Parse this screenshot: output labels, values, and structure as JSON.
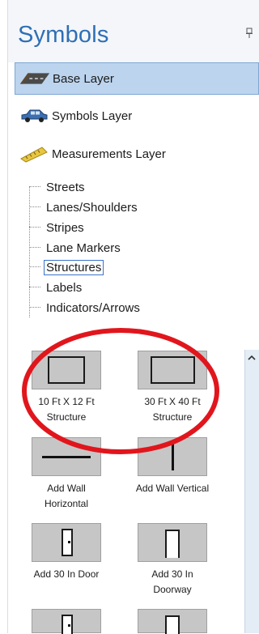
{
  "panel": {
    "title": "Symbols",
    "pin_icon": "pin-icon"
  },
  "layers": [
    {
      "label": "Base Layer",
      "icon": "asphalt-road-icon",
      "selected": true
    },
    {
      "label": "Symbols Layer",
      "icon": "car-icon",
      "selected": false
    },
    {
      "label": "Measurements Layer",
      "icon": "measuring-tape-icon",
      "selected": false
    }
  ],
  "categories": [
    {
      "label": "Streets",
      "selected": false
    },
    {
      "label": "Lanes/Shoulders",
      "selected": false
    },
    {
      "label": "Stripes",
      "selected": false
    },
    {
      "label": "Lane Markers",
      "selected": false
    },
    {
      "label": "Structures",
      "selected": true
    },
    {
      "label": "Labels",
      "selected": false
    },
    {
      "label": "Indicators/Arrows",
      "selected": false
    }
  ],
  "symbols": [
    {
      "line1": "10 Ft X 12 Ft",
      "line2": "Structure",
      "icon": "structure-10x12-icon"
    },
    {
      "line1": "30 Ft X 40 Ft",
      "line2": "Structure",
      "icon": "structure-30x40-icon"
    },
    {
      "line1": "Add Wall",
      "line2": "Horizontal",
      "icon": "wall-horizontal-icon"
    },
    {
      "line1": "Add Wall Vertical",
      "line2": "",
      "icon": "wall-vertical-icon"
    },
    {
      "line1": "Add 30 In Door",
      "line2": "",
      "icon": "door-icon"
    },
    {
      "line1": "Add 30 In",
      "line2": "Doorway",
      "icon": "doorway-icon"
    }
  ],
  "colors": {
    "title": "#2e6fb5",
    "selected_bg": "#bcd4ee",
    "annotation": "#e1161d"
  }
}
